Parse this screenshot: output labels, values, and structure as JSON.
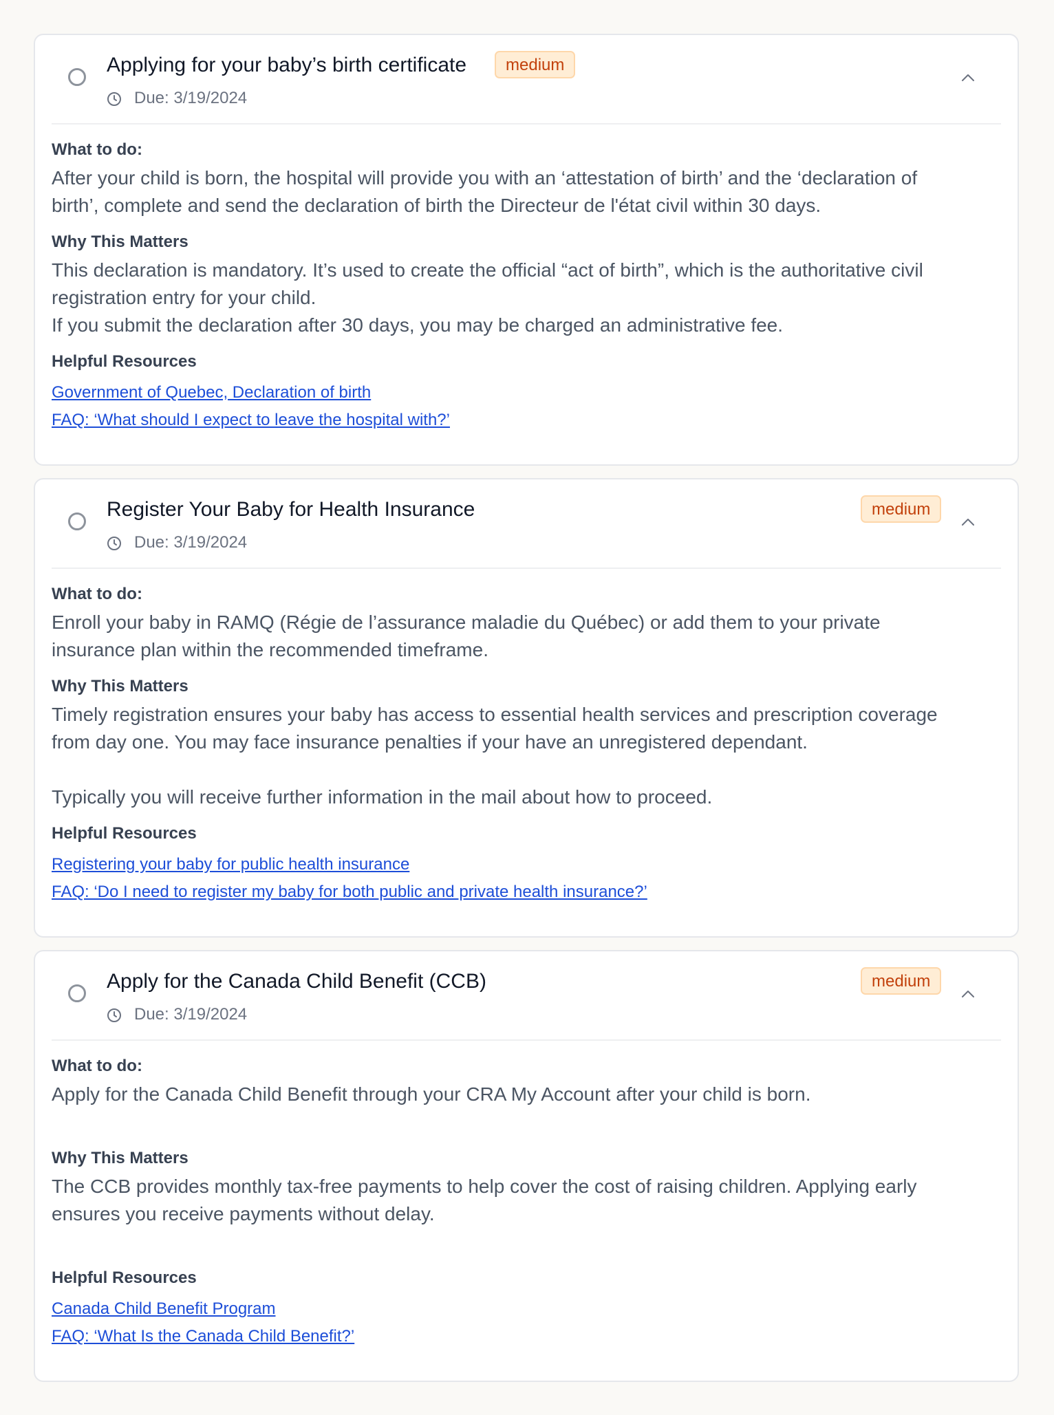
{
  "colors": {
    "page_bg": "#faf9f6",
    "badge_bg": "#ffedd5",
    "badge_text": "#c2410c",
    "link": "#1d4ed8"
  },
  "icons": [
    "circle-checkbox-icon",
    "clock-icon",
    "chevron-up-icon"
  ],
  "tasks": [
    {
      "title": "Applying for your baby’s birth certificate",
      "priority": "medium",
      "due": "Due: 3/19/2024",
      "what_label": "What to do:",
      "what_lines": [
        "After your child is born, the hospital will provide you with an ‘attestation of birth’ and the ‘declaration of",
        "birth’, complete and send the declaration of birth the Directeur de l'état civil within 30 days."
      ],
      "why_label": "Why This Matters",
      "why_lines": [
        "This declaration is mandatory. It’s used to create the official “act of birth”, which is the authoritative civil",
        "registration entry for your child.",
        "If you submit the declaration after 30 days, you may be charged an administrative fee."
      ],
      "resources_label": "Helpful Resources",
      "resources": [
        "Government of Quebec, Declaration of birth",
        "FAQ: ‘What should I expect to leave the hospital with?’"
      ]
    },
    {
      "title": "Register Your Baby for Health Insurance",
      "priority": "medium",
      "due": "Due: 3/19/2024",
      "what_label": "What to do:",
      "what_lines": [
        "Enroll your baby in RAMQ (Régie de l’assurance maladie du Québec) or add them to your private",
        "insurance plan within the recommended timeframe."
      ],
      "why_label": "Why This Matters",
      "why_lines": [
        "Timely registration ensures your baby has access to essential health services and prescription coverage",
        "from day one. You may face insurance penalties if your have an unregistered dependant.",
        "",
        "Typically you will receive further information in the mail about how to proceed."
      ],
      "resources_label": "Helpful Resources",
      "resources": [
        "Registering your baby for public health insurance",
        "FAQ: ‘Do I need to register my baby for both public and private health insurance?’"
      ]
    },
    {
      "title": "Apply for the Canada Child Benefit (CCB)",
      "priority": "medium",
      "due": "Due: 3/19/2024",
      "what_label": "What to do:",
      "what_lines": [
        "Apply for the Canada Child Benefit through your CRA My Account after your child is born.",
        ""
      ],
      "why_label": "Why This Matters",
      "why_lines": [
        "The CCB provides monthly tax-free payments to help cover the cost of raising children. Applying early",
        "ensures you receive payments without delay.",
        ""
      ],
      "resources_label": "Helpful Resources",
      "resources": [
        "Canada Child Benefit Program",
        "FAQ: ‘What Is the Canada Child Benefit?’"
      ]
    }
  ]
}
